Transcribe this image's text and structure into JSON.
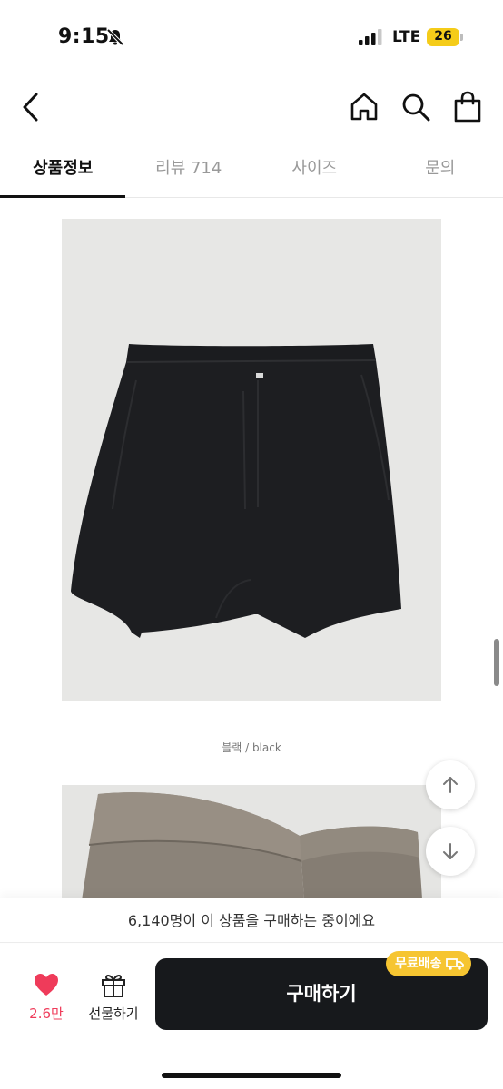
{
  "status_bar": {
    "time": "9:15",
    "network": "LTE",
    "battery": "26",
    "battery_color": "#f5cc19"
  },
  "nav": {
    "back_icon": "chevron-left-icon",
    "home_icon": "home-icon",
    "search_icon": "search-icon",
    "cart_icon": "shopping-bag-icon"
  },
  "tabs": [
    {
      "label": "상품정보",
      "active": true
    },
    {
      "label": "리뷰 714",
      "active": false
    },
    {
      "label": "사이즈",
      "active": false
    },
    {
      "label": "문의",
      "active": false
    }
  ],
  "product_images": [
    {
      "caption": "블랙 / black"
    }
  ],
  "buyers_notice": "6,140명이 이 상품을 구매하는 중이에요",
  "bottom_bar": {
    "like_count": "2.6만",
    "like_color": "#ef3b5a",
    "gift_label": "선물하기",
    "buy_label": "구매하기",
    "shipping_badge": "무료배송",
    "badge_color": "#f6c531"
  }
}
